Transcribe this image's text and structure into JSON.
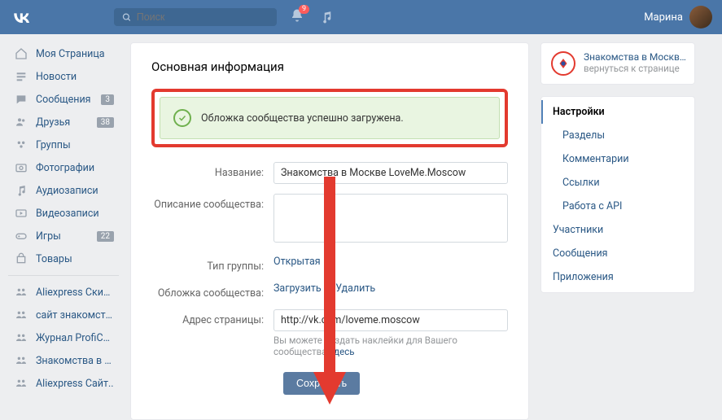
{
  "topbar": {
    "search_placeholder": "Поиск",
    "notif_count": "9",
    "username": "Марина"
  },
  "leftnav": {
    "items": [
      {
        "icon": "home",
        "label": "Моя Страница"
      },
      {
        "icon": "feed",
        "label": "Новости"
      },
      {
        "icon": "msg",
        "label": "Сообщения",
        "badge": "3"
      },
      {
        "icon": "friends",
        "label": "Друзья",
        "badge": "38"
      },
      {
        "icon": "groups",
        "label": "Группы"
      },
      {
        "icon": "photo",
        "label": "Фотографии"
      },
      {
        "icon": "audio",
        "label": "Аудиозаписи"
      },
      {
        "icon": "video",
        "label": "Видеозаписи"
      },
      {
        "icon": "games",
        "label": "Игры",
        "badge": "22"
      },
      {
        "icon": "goods",
        "label": "Товары"
      }
    ],
    "groups": [
      {
        "label": "Aliexpress Скид.."
      },
      {
        "label": "сайт знакомств.."
      },
      {
        "label": "Журнал ProfiCom.."
      },
      {
        "label": "Знакомства в Мо.."
      },
      {
        "label": "Aliexpress Сайт.."
      }
    ]
  },
  "main": {
    "heading": "Основная информация",
    "alert": "Обложка сообщества успешно загружена.",
    "labels": {
      "name": "Название:",
      "desc": "Описание сообщества:",
      "type": "Тип группы:",
      "cover": "Обложка сообщества:",
      "addr": "Адрес страницы:"
    },
    "values": {
      "name": "Знакомства в Москве LoveMe.Moscow",
      "type": "Открытая",
      "cover_upload": "Загрузить",
      "cover_delete": "Удалить",
      "addr": "http://vk.com/loveme.moscow"
    },
    "hint_prefix": "Вы можете создать наклейки для Вашего сообщества ",
    "hint_link": "здесь",
    "save_btn": "Сохранить"
  },
  "right": {
    "group_title": "Знакомства в Москве Lo...",
    "group_sub": "вернуться к странице",
    "menu": {
      "settings": "Настройки",
      "sections": "Разделы",
      "comments": "Комментарии",
      "links": "Ссылки",
      "api": "Работа с API",
      "members": "Участники",
      "messages": "Сообщения",
      "apps": "Приложения"
    }
  }
}
